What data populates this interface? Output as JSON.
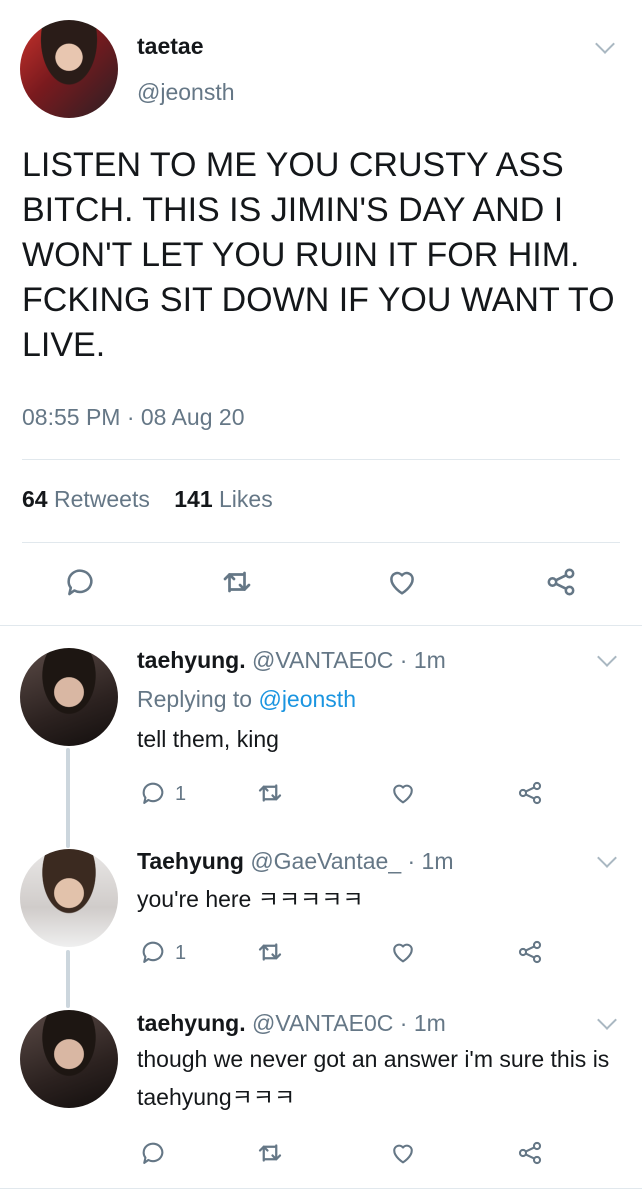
{
  "main_tweet": {
    "display_name": "taetae",
    "handle": "@jeonsth",
    "text": "LISTEN TO ME YOU CRUSTY ASS BITCH. THIS IS JIMIN'S DAY AND I WON'T LET YOU RUIN IT FOR HIM. FCKING SIT DOWN IF YOU WANT TO LIVE.",
    "timestamp": "08:55 PM · 08 Aug 20",
    "retweets_count": "64",
    "retweets_label": "Retweets",
    "likes_count": "141",
    "likes_label": "Likes"
  },
  "replies": [
    {
      "display_name": "taehyung.",
      "handle_time": "@VANTAE0C · 1m",
      "replying_prefix": "Replying to ",
      "replying_to": "@jeonsth",
      "text": "tell them, king",
      "reply_count": "1"
    },
    {
      "display_name": "Taehyung",
      "handle_time": "@GaeVantae_ · 1m",
      "text": "you're here ㅋㅋㅋㅋㅋ",
      "reply_count": "1"
    },
    {
      "display_name": "taehyung.",
      "handle_time": "@VANTAE0C · 1m",
      "text": "though we never got an answer i'm sure this is taehyungㅋㅋㅋ"
    }
  ],
  "icons": {
    "reply": "speech-bubble",
    "retweet": "retweet-arrows",
    "like": "heart-outline",
    "share": "share-nodes",
    "menu": "chevron-down"
  },
  "colors": {
    "text": "#14171a",
    "secondary": "#657786",
    "link": "#1b95e0",
    "divider": "#e1e8ed"
  }
}
